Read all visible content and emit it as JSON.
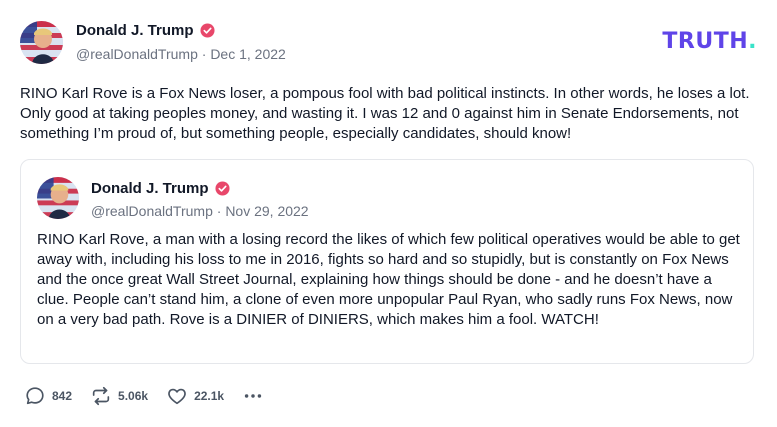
{
  "brand": {
    "text": "TRUTH",
    "dot": ".",
    "color": "#5f44e8",
    "dot_color": "#39e3c9"
  },
  "post": {
    "author_name": "Donald J. Trump",
    "handle": "@realDonaldTrump",
    "separator": " · ",
    "date": "Dec 1, 2022",
    "text": "RINO Karl Rove is a Fox News loser, a pompous fool with bad political instincts. In other words, he loses a lot. Only good at taking peoples money, and wasting it. I was 12 and 0 against him in Senate Endorsements, not something I’m proud of, but something people, especially candidates, should know!"
  },
  "quoted_post": {
    "author_name": "Donald J. Trump",
    "handle": "@realDonaldTrump",
    "separator": " · ",
    "date": "Nov 29, 2022",
    "text": "RINO Karl Rove, a man with a losing record the likes of which few political operatives would be able to get away with, including his loss to me in 2016, fights so hard and so stupidly, but is constantly on Fox News and the once great Wall Street Journal, explaining how things should be done - and he doesn’t have a clue. People can’t stand him, a clone of even more unpopular Paul Ryan, who sadly runs Fox News, now on a very bad path. Rove is a DINIER of DINIERS, which makes him a fool. WATCH!"
  },
  "actions": {
    "replies": "842",
    "retruths": "5.06k",
    "likes": "22.1k",
    "icons": [
      "reply-icon",
      "retruth-icon",
      "like-icon",
      "more-icon"
    ]
  },
  "colors": {
    "verified_badge": "#e8476a",
    "meta_text": "#6b7280"
  }
}
